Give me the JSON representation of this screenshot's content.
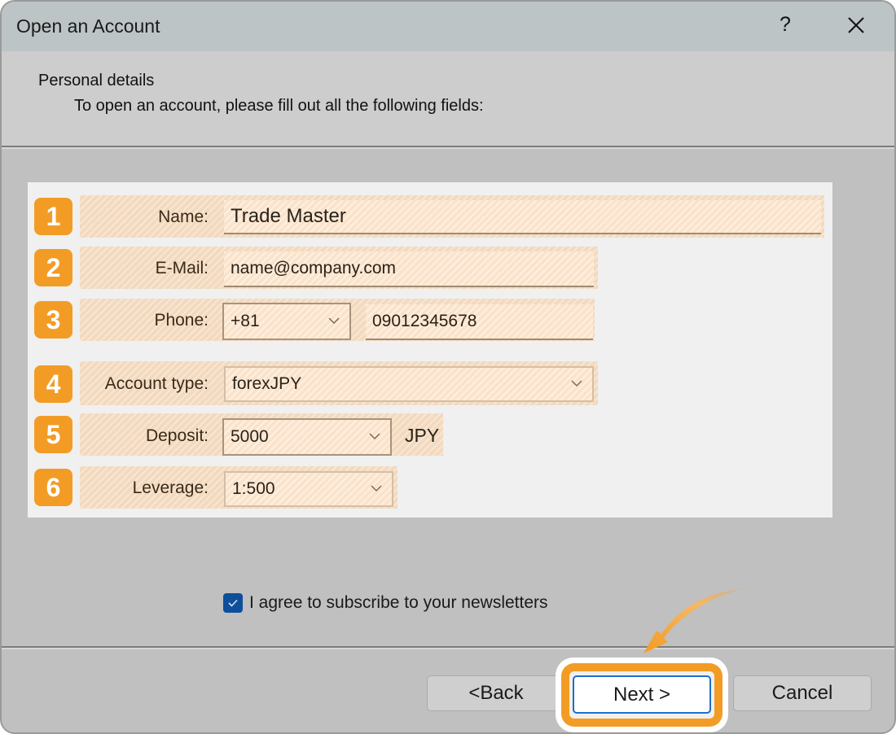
{
  "window": {
    "title": "Open an Account",
    "help_label": "?",
    "close_icon": "close-icon"
  },
  "header": {
    "title": "Personal details",
    "subtitle": "To open an account, please fill out all the following fields:"
  },
  "form": {
    "rows": [
      {
        "badge": "1",
        "label": "Name:",
        "value": "Trade Master"
      },
      {
        "badge": "2",
        "label": "E-Mail:",
        "value": "name@company.com"
      },
      {
        "badge": "3",
        "label": "Phone:",
        "country_code": "+81",
        "value": "09012345678"
      },
      {
        "badge": "4",
        "label": "Account type:",
        "value": "forexJPY"
      },
      {
        "badge": "5",
        "label": "Deposit:",
        "value": "5000",
        "currency": "JPY"
      },
      {
        "badge": "6",
        "label": "Leverage:",
        "value": "1:500"
      }
    ]
  },
  "newsletter": {
    "label": "I agree to subscribe to your newsletters",
    "checked": true
  },
  "buttons": {
    "back": "<Back",
    "next": "Next >",
    "cancel": "Cancel"
  },
  "colors": {
    "accent": "#f39c25",
    "checkbox": "#0d4f9a",
    "focus": "#1e6fc9"
  }
}
